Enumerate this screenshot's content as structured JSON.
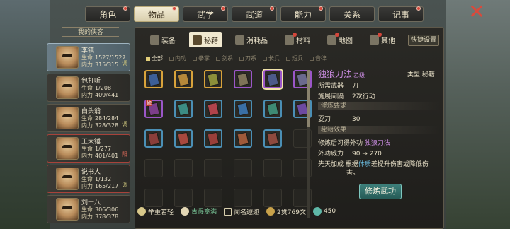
{
  "top_tabs": [
    {
      "label": "角色",
      "dot": true
    },
    {
      "label": "物品",
      "dot": true,
      "active": true
    },
    {
      "label": "武学",
      "dot": true
    },
    {
      "label": "武道",
      "dot": true
    },
    {
      "label": "能力",
      "dot": true
    },
    {
      "label": "关系",
      "dot": false
    },
    {
      "label": "记事",
      "dot": true
    }
  ],
  "sidebar": {
    "title": "我的侠客",
    "stat_hp_label": "生命",
    "stat_mp_label": "内力",
    "characters": [
      {
        "name": "李镇",
        "hp": "1527/1527",
        "mp": "315/315",
        "flag": "调",
        "selected": true
      },
      {
        "name": "包打听",
        "hp": "1/208",
        "mp": "409/441",
        "flag": ""
      },
      {
        "name": "白头翁",
        "hp": "284/284",
        "mp": "328/328",
        "flag": "调"
      },
      {
        "name": "王大锤",
        "hp": "1/277",
        "mp": "401/401",
        "flag": "阳",
        "red": true
      },
      {
        "name": "说书人",
        "hp": "1/132",
        "mp": "165/217",
        "flag": "调",
        "red": true
      },
      {
        "name": "刘十八",
        "hp": "306/306",
        "mp": "378/378",
        "flag": ""
      }
    ]
  },
  "sub_tabs": [
    {
      "label": "装备",
      "badge": false
    },
    {
      "label": "秘籍",
      "badge": false,
      "active": true
    },
    {
      "label": "消耗品",
      "badge": false
    },
    {
      "label": "材料",
      "badge": true
    },
    {
      "label": "地图",
      "badge": true
    },
    {
      "label": "其他",
      "badge": true
    }
  ],
  "quick_settings": "快捷设置",
  "filters": [
    "全部",
    "内功",
    "拳掌",
    "剑系",
    "刀系",
    "长兵",
    "短兵",
    "音律"
  ],
  "detail": {
    "title": "独狼刀法",
    "grade": "乙级",
    "type_label": "类型",
    "type_value": "秘籍",
    "weapon_label": "所需武器",
    "weapon_value": "刀",
    "interval_label": "施展间隔",
    "interval_value": "2次行动",
    "req_section": "修炼要求",
    "req_label": "耍刀",
    "req_value": "30",
    "effect_section": "秘籍效果",
    "effect_learn_prefix": "修炼后习得外功",
    "effect_learn_value": "独狼刀法",
    "power_label": "外功威力",
    "power_value": "90 → 270",
    "innate_prefix": "先天加成",
    "innate_text_a": "根据",
    "innate_highlight": "体质",
    "innate_text_b": "差提升伤害或降低伤",
    "innate_text_c": "害。"
  },
  "train_button": "修炼武功",
  "bottom_bar": {
    "skill1": "举重若轻",
    "skill2": "吉得意满",
    "skill3": "闻名遐迩",
    "money": "2贯769文",
    "gems": "450"
  },
  "colors": {
    "rarity_gold": "#d9a33b",
    "rarity_purple": "#9b56c8",
    "rarity_blue": "#4b8fb5",
    "accent_purple_text": "#c98be0",
    "train_button": "#3d7f7a"
  }
}
